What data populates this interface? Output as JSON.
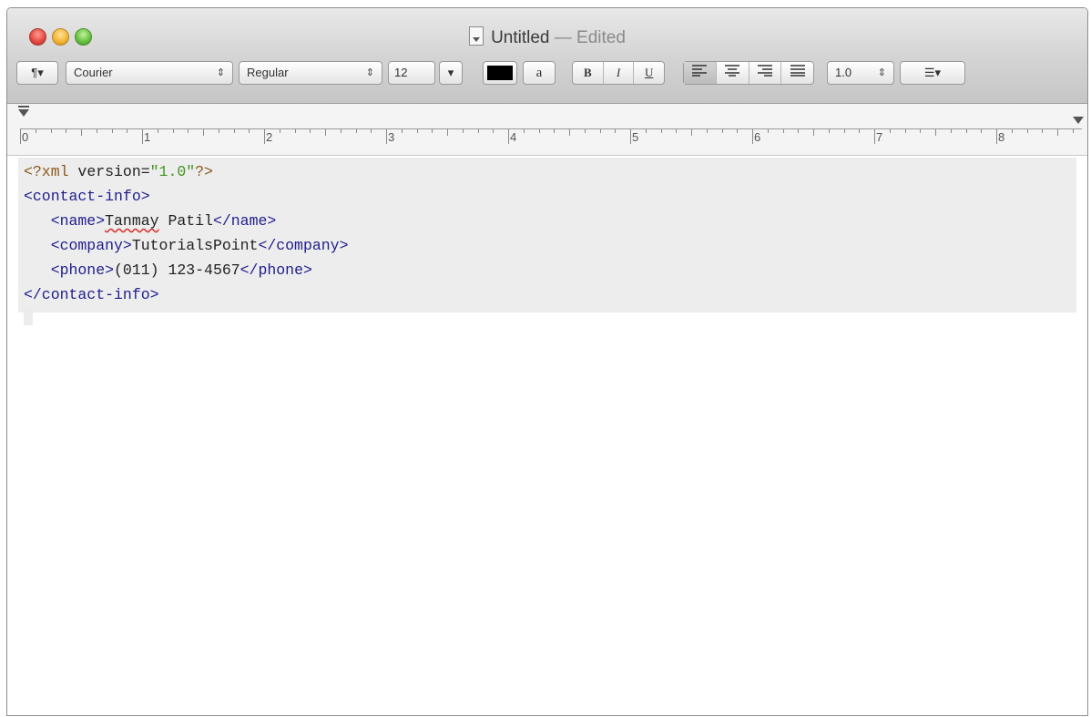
{
  "window": {
    "title": "Untitled",
    "status": "— Edited"
  },
  "toolbar": {
    "paragraph_label": "¶▾",
    "font_family": "Courier",
    "font_style": "Regular",
    "font_size": "12",
    "size_menu": "▾",
    "text_color": "#000000",
    "highlight_label": "a",
    "bold": "B",
    "italic": "I",
    "underline": "U",
    "spacing": "1.0",
    "list_label": "☰▾",
    "stepper": "⇕"
  },
  "ruler": {
    "labels": [
      "0",
      "1",
      "2",
      "3",
      "4",
      "5",
      "6",
      "7",
      "8"
    ]
  },
  "document": {
    "line1_pi_open": "<?xml",
    "line1_attr": " version=",
    "line1_value": "\"1.0\"",
    "line1_pi_close": "?>",
    "line2": "<contact-info>",
    "line3_open": "   <name>",
    "line3_first": "Tanmay",
    "line3_last": " Patil",
    "line3_close": "</name>",
    "line4_open": "   <company>",
    "line4_text": "TutorialsPoint",
    "line4_close": "</company>",
    "line5_open": "   <phone>",
    "line5_text": "(011) 123-4567",
    "line5_close": "</phone>",
    "line6": "</contact-info>"
  }
}
